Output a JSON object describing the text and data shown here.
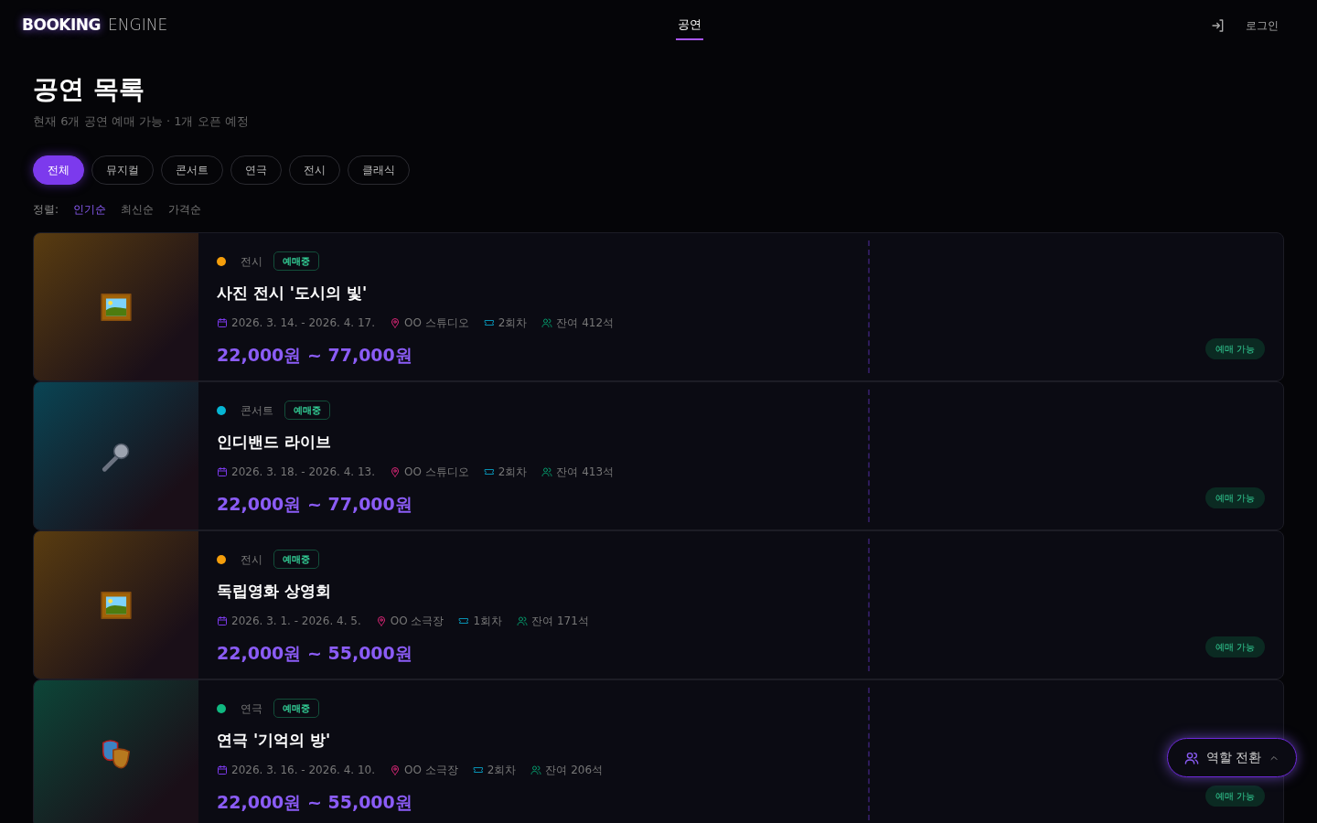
{
  "brand": {
    "bold": "BOOKING",
    "light": "ENGINE"
  },
  "nav": [
    {
      "label": "공연",
      "selected": true
    }
  ],
  "login": "로그인",
  "heading": "공연 목록",
  "summary": "현재 6개 공연 예매 가능 · 1개 오픈 예정",
  "filters": [
    {
      "label": "전체",
      "selected": true
    },
    {
      "label": "뮤지컬",
      "selected": false
    },
    {
      "label": "콘서트",
      "selected": false
    },
    {
      "label": "연극",
      "selected": false
    },
    {
      "label": "전시",
      "selected": false
    },
    {
      "label": "클래식",
      "selected": false
    }
  ],
  "sort": {
    "label": "정렬:",
    "options": [
      {
        "label": "인기순",
        "selected": true
      },
      {
        "label": "최신순",
        "selected": false
      },
      {
        "label": "가격순",
        "selected": false
      }
    ]
  },
  "shows": [
    {
      "kind": "frame",
      "color": "#f59e0b",
      "category": "전시",
      "status": "예매중",
      "title": "사진 전시 '도시의 빛'",
      "dates": "2026. 3. 14. - 2026. 4. 17.",
      "venue": "OO 스튜디오",
      "sessions": "2회차",
      "remaining": "잔여 412석",
      "price": "22,000원 ~ 77,000원",
      "availability": "예매 가능"
    },
    {
      "kind": "mic",
      "color": "#06b6d4",
      "category": "콘서트",
      "status": "예매중",
      "title": "인디밴드 라이브",
      "dates": "2026. 3. 18. - 2026. 4. 13.",
      "venue": "OO 스튜디오",
      "sessions": "2회차",
      "remaining": "잔여 413석",
      "price": "22,000원 ~ 77,000원",
      "availability": "예매 가능"
    },
    {
      "kind": "frame",
      "color": "#f59e0b",
      "category": "전시",
      "status": "예매중",
      "title": "독립영화 상영회",
      "dates": "2026. 3. 1. - 2026. 4. 5.",
      "venue": "OO 소극장",
      "sessions": "1회차",
      "remaining": "잔여 171석",
      "price": "22,000원 ~ 55,000원",
      "availability": "예매 가능"
    },
    {
      "kind": "masks",
      "color": "#10b981",
      "category": "연극",
      "status": "예매중",
      "title": "연극 '기억의 방'",
      "dates": "2026. 3. 16. - 2026. 4. 10.",
      "venue": "OO 소극장",
      "sessions": "2회차",
      "remaining": "잔여 206석",
      "price": "22,000원 ~ 55,000원",
      "availability": "예매 가능"
    }
  ],
  "role_switch": "역할 전환"
}
